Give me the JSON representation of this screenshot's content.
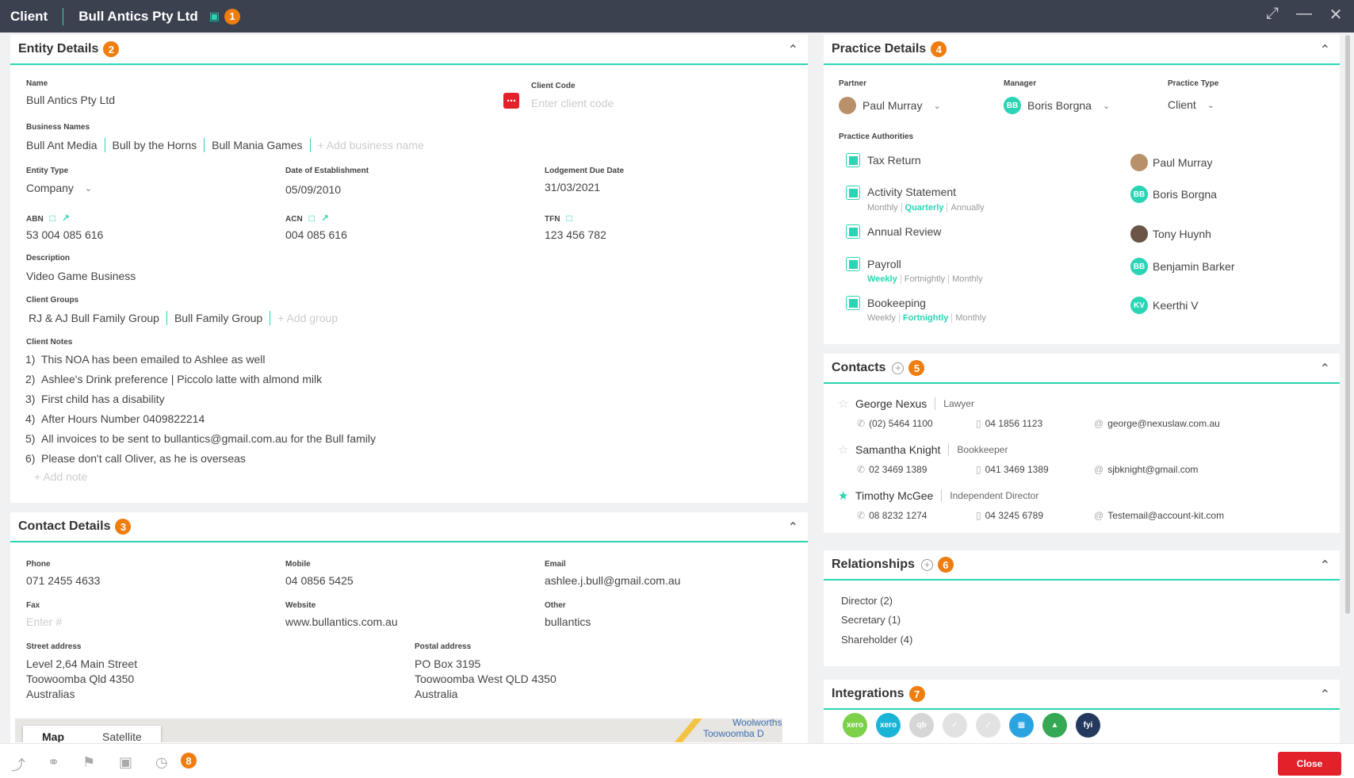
{
  "window": {
    "label": "Client",
    "client_name": "Bull Antics Pty Ltd",
    "badge": "1"
  },
  "entity": {
    "title": "Entity Details",
    "badge": "2",
    "name_label": "Name",
    "name": "Bull Antics Pty Ltd",
    "code_label": "Client Code",
    "code_placeholder": "Enter client code",
    "business_names_label": "Business Names",
    "business_names": [
      "Bull Ant Media",
      "Bull by the Horns",
      "Bull Mania Games"
    ],
    "add_business": "+ Add business name",
    "entity_type_label": "Entity Type",
    "entity_type": "Company",
    "doe_label": "Date of Establishment",
    "doe": "05/09/2010",
    "ldd_label": "Lodgement Due Date",
    "ldd": "31/03/2021",
    "abn_label": "ABN",
    "abn": "53 004 085 616",
    "acn_label": "ACN",
    "acn": "004 085 616",
    "tfn_label": "TFN",
    "tfn": "123 456 782",
    "desc_label": "Description",
    "desc": "Video Game Business",
    "groups_label": "Client Groups",
    "groups": [
      "RJ & AJ Bull Family Group",
      "Bull Family Group"
    ],
    "add_group": "+ Add group",
    "notes_label": "Client Notes",
    "notes": [
      {
        "n": "1)",
        "text": "This NOA has been emailed to Ashlee as well"
      },
      {
        "n": "2)",
        "text": "Ashlee's Drink preference | Piccolo latte with almond milk"
      },
      {
        "n": "3)",
        "text": "First child has a disability"
      },
      {
        "n": "4)",
        "text": "After Hours Number 0409822214"
      },
      {
        "n": "5)",
        "text": "All invoices to be sent to bullantics@gmail.com.au for the Bull family"
      },
      {
        "n": "6)",
        "text": "Please don't call Oliver, as he is overseas"
      }
    ],
    "add_note": "+ Add note"
  },
  "contact_details": {
    "title": "Contact Details",
    "badge": "3",
    "phone_label": "Phone",
    "phone": "071 2455 4633",
    "mobile_label": "Mobile",
    "mobile": "04 0856 5425",
    "email_label": "Email",
    "email": "ashlee.j.bull@gmail.com.au",
    "fax_label": "Fax",
    "fax_placeholder": "Enter #",
    "website_label": "Website",
    "website": "www.bullantics.com.au",
    "other_label": "Other",
    "other": "bullantics",
    "street_label": "Street address",
    "street": [
      "Level 2,64 Main Street",
      "Toowoomba Qld 4350",
      "Australias"
    ],
    "postal_label": "Postal address",
    "postal": [
      "PO Box 3195",
      "Toowoomba West QLD 4350",
      "Australia"
    ],
    "map_tab_map": "Map",
    "map_tab_sat": "Satellite",
    "map_place1": "Woolworths",
    "map_place2": "Toowoomba D"
  },
  "practice": {
    "title": "Practice Details",
    "badge": "4",
    "partner_label": "Partner",
    "partner": "Paul Murray",
    "manager_label": "Manager",
    "manager": "Boris Borgna",
    "manager_initials": "BB",
    "ptype_label": "Practice Type",
    "ptype": "Client",
    "auth_label": "Practice Authorities",
    "authorities": [
      {
        "title": "Tax Return",
        "person": "Paul Murray",
        "initials": ""
      },
      {
        "title": "Activity Statement",
        "person": "Boris Borgna",
        "initials": "BB",
        "freq": [
          "Monthly",
          "Quarterly",
          "Annually"
        ]
      },
      {
        "title": "Annual Review",
        "person": "Tony Huynh",
        "initials": ""
      },
      {
        "title": "Payroll",
        "person": "Benjamin Barker",
        "initials": "BB",
        "freq": [
          "Weekly",
          "Fortnightly",
          "Monthly"
        ]
      },
      {
        "title": "Bookeeping",
        "person": "Keerthi V",
        "initials": "KV",
        "freq": [
          "Weekly",
          "Fortnightly",
          "Monthly"
        ]
      }
    ]
  },
  "contacts": {
    "title": "Contacts",
    "badge": "5",
    "items": [
      {
        "name": "George Nexus",
        "role": "Lawyer",
        "phone": "(02) 5464 1100",
        "mobile": "04 1856 1123",
        "email": "george@nexuslaw.com.au",
        "starred": false
      },
      {
        "name": "Samantha Knight",
        "role": "Bookkeeper",
        "phone": "02 3469 1389",
        "mobile": "041 3469 1389",
        "email": "sjbknight@gmail.com",
        "starred": false
      },
      {
        "name": "Timothy McGee",
        "role": "Independent Director",
        "phone": "08 8232 1274",
        "mobile": "04 3245 6789",
        "email": "Testemail@account-kit.com",
        "starred": true
      }
    ]
  },
  "relationships": {
    "title": "Relationships",
    "badge": "6",
    "items": [
      "Director (2)",
      "Secretary (1)",
      "Shareholder (4)"
    ]
  },
  "integrations": {
    "title": "Integrations",
    "badge": "7",
    "items": [
      {
        "label": "xero",
        "color": "#7bd148"
      },
      {
        "label": "xero",
        "color": "#1ab4d7"
      },
      {
        "label": "qb",
        "color": "#d6d6d6"
      },
      {
        "label": "",
        "color": "#e2e2e2"
      },
      {
        "label": "",
        "color": "#e2e2e2"
      },
      {
        "label": "",
        "color": "#2aa3e0"
      },
      {
        "label": "",
        "color": "#34a853"
      },
      {
        "label": "fyi",
        "color": "#23395d"
      }
    ]
  },
  "footer": {
    "badge": "8",
    "close": "Close"
  }
}
